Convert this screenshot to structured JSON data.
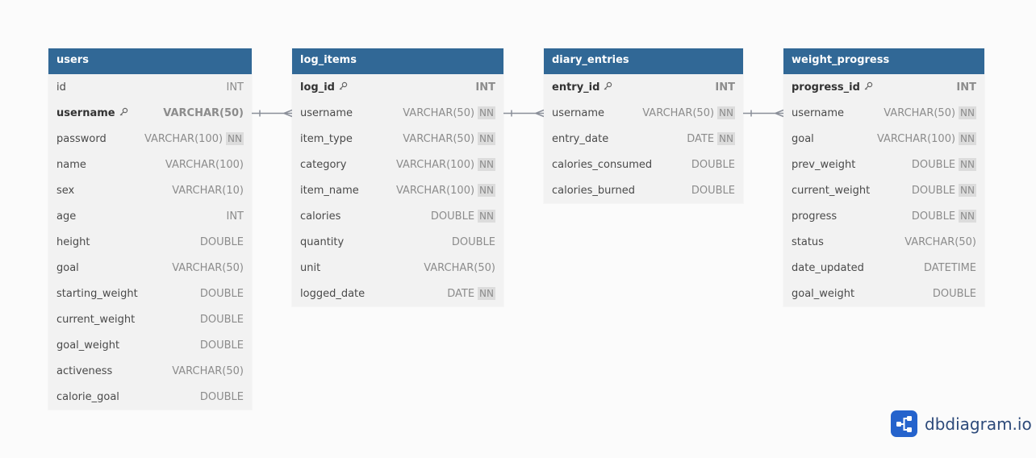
{
  "tables": [
    {
      "id": "users",
      "name": "users",
      "fields": [
        {
          "name": "id",
          "type": "INT",
          "nn": false,
          "pk": false
        },
        {
          "name": "username",
          "type": "VARCHAR(50)",
          "nn": false,
          "pk": true
        },
        {
          "name": "password",
          "type": "VARCHAR(100)",
          "nn": true,
          "pk": false
        },
        {
          "name": "name",
          "type": "VARCHAR(100)",
          "nn": false,
          "pk": false
        },
        {
          "name": "sex",
          "type": "VARCHAR(10)",
          "nn": false,
          "pk": false
        },
        {
          "name": "age",
          "type": "INT",
          "nn": false,
          "pk": false
        },
        {
          "name": "height",
          "type": "DOUBLE",
          "nn": false,
          "pk": false
        },
        {
          "name": "goal",
          "type": "VARCHAR(50)",
          "nn": false,
          "pk": false
        },
        {
          "name": "starting_weight",
          "type": "DOUBLE",
          "nn": false,
          "pk": false
        },
        {
          "name": "current_weight",
          "type": "DOUBLE",
          "nn": false,
          "pk": false
        },
        {
          "name": "goal_weight",
          "type": "DOUBLE",
          "nn": false,
          "pk": false
        },
        {
          "name": "activeness",
          "type": "VARCHAR(50)",
          "nn": false,
          "pk": false
        },
        {
          "name": "calorie_goal",
          "type": "DOUBLE",
          "nn": false,
          "pk": false
        }
      ]
    },
    {
      "id": "log_items",
      "name": "log_items",
      "fields": [
        {
          "name": "log_id",
          "type": "INT",
          "nn": false,
          "pk": true
        },
        {
          "name": "username",
          "type": "VARCHAR(50)",
          "nn": true,
          "pk": false
        },
        {
          "name": "item_type",
          "type": "VARCHAR(50)",
          "nn": true,
          "pk": false
        },
        {
          "name": "category",
          "type": "VARCHAR(100)",
          "nn": true,
          "pk": false
        },
        {
          "name": "item_name",
          "type": "VARCHAR(100)",
          "nn": true,
          "pk": false
        },
        {
          "name": "calories",
          "type": "DOUBLE",
          "nn": true,
          "pk": false
        },
        {
          "name": "quantity",
          "type": "DOUBLE",
          "nn": false,
          "pk": false
        },
        {
          "name": "unit",
          "type": "VARCHAR(50)",
          "nn": false,
          "pk": false
        },
        {
          "name": "logged_date",
          "type": "DATE",
          "nn": true,
          "pk": false
        }
      ]
    },
    {
      "id": "diary_entries",
      "name": "diary_entries",
      "fields": [
        {
          "name": "entry_id",
          "type": "INT",
          "nn": false,
          "pk": true
        },
        {
          "name": "username",
          "type": "VARCHAR(50)",
          "nn": true,
          "pk": false
        },
        {
          "name": "entry_date",
          "type": "DATE",
          "nn": true,
          "pk": false
        },
        {
          "name": "calories_consumed",
          "type": "DOUBLE",
          "nn": false,
          "pk": false
        },
        {
          "name": "calories_burned",
          "type": "DOUBLE",
          "nn": false,
          "pk": false
        }
      ]
    },
    {
      "id": "weight_progress",
      "name": "weight_progress",
      "fields": [
        {
          "name": "progress_id",
          "type": "INT",
          "nn": false,
          "pk": true
        },
        {
          "name": "username",
          "type": "VARCHAR(50)",
          "nn": true,
          "pk": false
        },
        {
          "name": "goal",
          "type": "VARCHAR(100)",
          "nn": true,
          "pk": false
        },
        {
          "name": "prev_weight",
          "type": "DOUBLE",
          "nn": true,
          "pk": false
        },
        {
          "name": "current_weight",
          "type": "DOUBLE",
          "nn": true,
          "pk": false
        },
        {
          "name": "progress",
          "type": "DOUBLE",
          "nn": true,
          "pk": false
        },
        {
          "name": "status",
          "type": "VARCHAR(50)",
          "nn": false,
          "pk": false
        },
        {
          "name": "date_updated",
          "type": "DATETIME",
          "nn": false,
          "pk": false
        },
        {
          "name": "goal_weight",
          "type": "DOUBLE",
          "nn": false,
          "pk": false
        }
      ]
    }
  ],
  "nn_label": "NN",
  "relationships": [
    {
      "from": "users.username",
      "to": "log_items.username",
      "type": "one-to-many"
    },
    {
      "from": "log_items.username",
      "to": "diary_entries.username",
      "type": "one-to-many"
    },
    {
      "from": "diary_entries.username",
      "to": "weight_progress.username",
      "type": "one-to-many"
    }
  ],
  "brand": {
    "name": "dbdiagram.io",
    "icon": "share-nodes-icon"
  },
  "colors": {
    "header": "#316896",
    "body": "#f2f2f2",
    "connector": "#8a8f99",
    "brand": "#2563cc"
  }
}
